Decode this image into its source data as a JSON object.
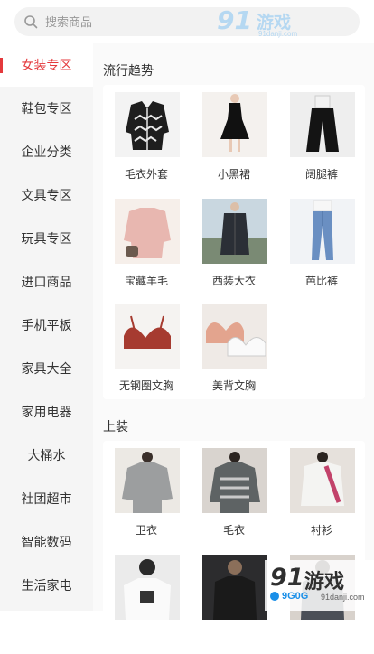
{
  "search": {
    "placeholder": "搜索商品"
  },
  "watermark_top": {
    "num": "91",
    "text": "游戏",
    "sub": "91danji.com"
  },
  "sidebar": {
    "items": [
      {
        "label": "女装专区",
        "active": true
      },
      {
        "label": "鞋包专区"
      },
      {
        "label": "企业分类"
      },
      {
        "label": "文具专区"
      },
      {
        "label": "玩具专区"
      },
      {
        "label": "进口商品"
      },
      {
        "label": "手机平板"
      },
      {
        "label": "家具大全"
      },
      {
        "label": "家用电器"
      },
      {
        "label": "大桶水"
      },
      {
        "label": "社团超市"
      },
      {
        "label": "智能数码"
      },
      {
        "label": "生活家电"
      }
    ]
  },
  "sections": [
    {
      "title": "流行趋势",
      "items": [
        {
          "label": "毛衣外套",
          "icon": "cardigan-image"
        },
        {
          "label": "小黑裙",
          "icon": "black-dress-image"
        },
        {
          "label": "阔腿裤",
          "icon": "wide-leg-pants-image"
        },
        {
          "label": "宝藏羊毛",
          "icon": "wool-sweater-image"
        },
        {
          "label": "西装大衣",
          "icon": "coat-image"
        },
        {
          "label": "芭比裤",
          "icon": "jeans-image"
        },
        {
          "label": "无钢圈文胸",
          "icon": "wireless-bra-image"
        },
        {
          "label": "美背文胸",
          "icon": "lace-bra-image"
        }
      ]
    },
    {
      "title": "上装",
      "items": [
        {
          "label": "卫衣",
          "icon": "hoodie-image"
        },
        {
          "label": "毛衣",
          "icon": "sweater-image"
        },
        {
          "label": "衬衫",
          "icon": "shirt-image"
        },
        {
          "label": "",
          "icon": "tshirt-image"
        },
        {
          "label": "",
          "icon": "jacket-image"
        },
        {
          "label": "",
          "icon": "top-image"
        }
      ]
    }
  ],
  "watermark_bottom": {
    "num": "91",
    "text": "游戏",
    "cn": "9G0G",
    "url": "91danji.com"
  },
  "colors": {
    "accent": "#e4393c",
    "sidebar_bg": "#f5f5f5",
    "content_bg": "#fafafa"
  }
}
